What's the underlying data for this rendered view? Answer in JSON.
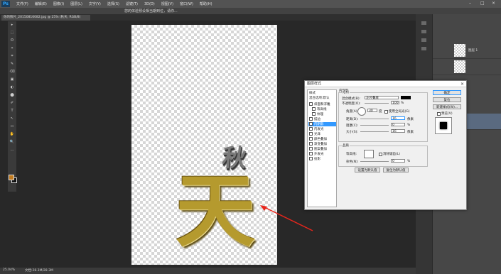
{
  "app": {
    "logo": "Ps",
    "menu": [
      "文件(F)",
      "编辑(E)",
      "图像(I)",
      "图层(L)",
      "文字(Y)",
      "选择(S)",
      "滤镜(T)",
      "3D(D)",
      "视图(V)",
      "窗口(W)",
      "帮助(H)"
    ],
    "window_controls": [
      "–",
      "□",
      "×"
    ]
  },
  "options_bar": {
    "hint": "您的体验预设相当期到位，请你..."
  },
  "document": {
    "tab_title": "你的照片_20150816082.jpg @ 25% (秋天, RGB/8)",
    "zoom": "25.04%",
    "doc_info": "文档:28.3M/28.3M"
  },
  "canvas_text": {
    "char_small": "秋",
    "char_large": "天"
  },
  "tools": [
    "▸",
    "⬚",
    "ʘ",
    "⌖",
    "⌗",
    "✎",
    "⌫",
    "▣",
    "◐",
    "⬤",
    "✐",
    "T",
    "↖",
    "▭",
    "✋",
    "🔍",
    "…"
  ],
  "colors": {
    "foreground": "#c27b1f",
    "background": "#111111",
    "highlight": "#3399ff"
  },
  "layers": {
    "layer_name": "图层 1"
  },
  "dialog": {
    "title": "图层样式",
    "close": "×",
    "styles_header": "样式",
    "blend_options": "混合选项:默认",
    "styles": [
      {
        "label": "斜面和浮雕",
        "checked": false
      },
      {
        "label": "等高线",
        "checked": false
      },
      {
        "label": "纹理",
        "checked": false
      },
      {
        "label": "描边",
        "checked": false
      },
      {
        "label": "内阴影",
        "checked": true,
        "selected": true
      },
      {
        "label": "内发光",
        "checked": false
      },
      {
        "label": "光泽",
        "checked": false
      },
      {
        "label": "颜色叠加",
        "checked": false
      },
      {
        "label": "渐变叠加",
        "checked": false
      },
      {
        "label": "图案叠加",
        "checked": false
      },
      {
        "label": "外发光",
        "checked": false
      },
      {
        "label": "投影",
        "checked": false
      }
    ],
    "section_title": "内阴影",
    "structure": {
      "title": "结构",
      "blend_mode_label": "混合模式(B):",
      "blend_mode_value": "正片叠底",
      "opacity_label": "不透明度(O):",
      "opacity_value": "100",
      "opacity_unit": "%",
      "angle_label": "角度(A):",
      "angle_value": "30",
      "angle_unit": "度",
      "global_light_label": "使用全局光(G)",
      "distance_label": "距离(D):",
      "distance_value": "16",
      "distance_unit": "像素",
      "choke_label": "阻塞(C):",
      "choke_value": "0",
      "choke_unit": "%",
      "size_label": "大小(S):",
      "size_value": "16",
      "size_unit": "像素"
    },
    "quality": {
      "title": "品质",
      "contour_label": "等高线:",
      "antialias_label": "消除锯齿(L)",
      "noise_label": "杂色(N):",
      "noise_value": "0",
      "noise_unit": "%"
    },
    "buttons": {
      "make_default": "设置为默认值",
      "reset_default": "复位为默认值",
      "ok": "确定",
      "cancel": "复位",
      "new_style": "新建样式(W)...",
      "preview": "预览(V)"
    }
  }
}
